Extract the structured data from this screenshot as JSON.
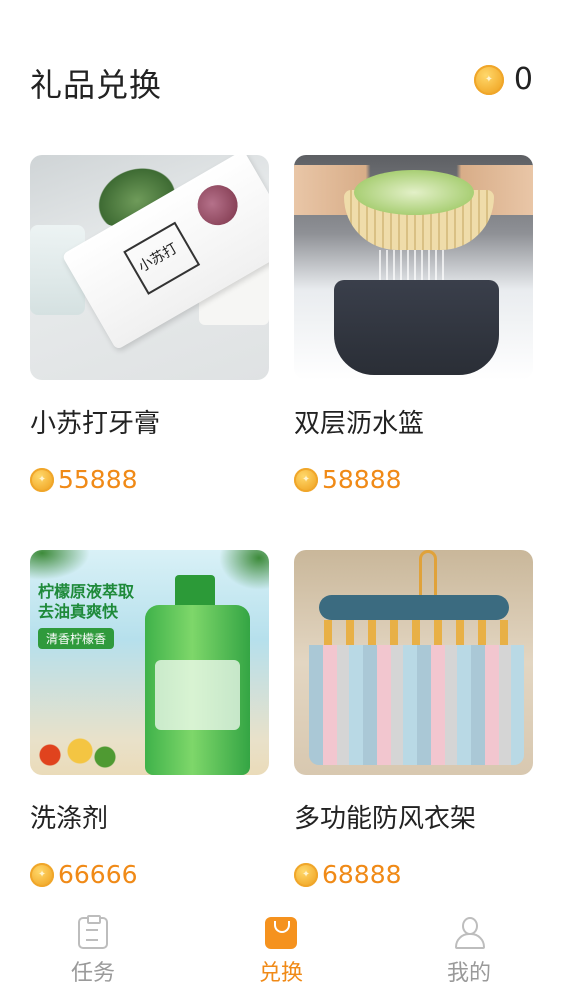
{
  "header": {
    "title": "礼品兑换",
    "balance": "0",
    "coin_icon": "coin-icon"
  },
  "products": [
    {
      "name": "小苏打牙膏",
      "price": "55888",
      "image_label": "小苏打"
    },
    {
      "name": "双层沥水篮",
      "price": "58888"
    },
    {
      "name": "洗涤剂",
      "price": "66666",
      "image_text": "柠檬原液萃取\n去油真爽快",
      "image_tag": "清香柠檬香"
    },
    {
      "name": "多功能防风衣架",
      "price": "68888"
    }
  ],
  "tabbar": {
    "tabs": [
      {
        "label": "任务",
        "icon": "task-clipboard-icon",
        "active": false
      },
      {
        "label": "兑换",
        "icon": "shopping-bag-icon",
        "active": true
      },
      {
        "label": "我的",
        "icon": "user-icon",
        "active": false
      }
    ]
  },
  "colors": {
    "accent": "#f08a17",
    "inactive": "#9a9a9a",
    "text": "#222222"
  }
}
